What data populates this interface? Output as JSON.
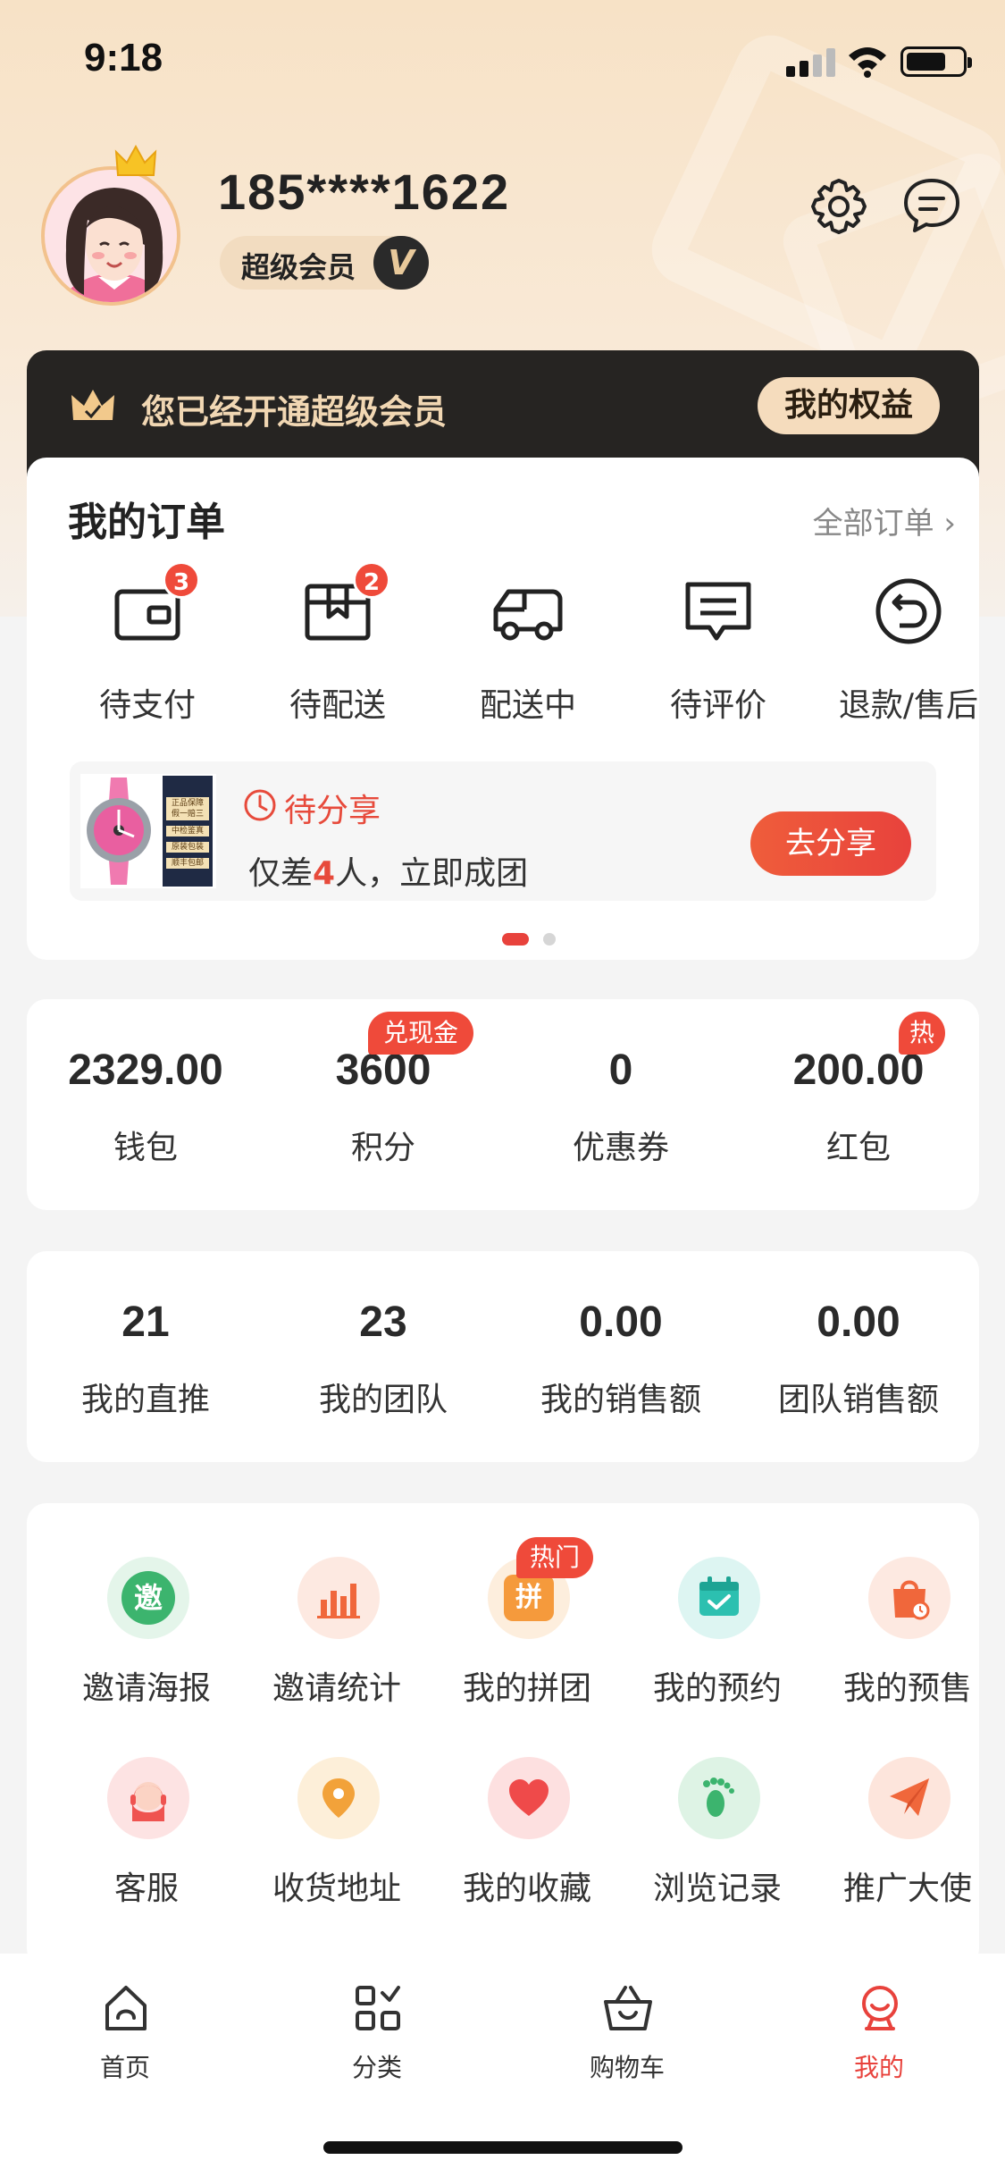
{
  "status_bar": {
    "time": "9:18",
    "battery_level": 0.7
  },
  "profile": {
    "phone": "185****1622",
    "member_label": "超级会员",
    "member_mark": "V"
  },
  "vip_banner": {
    "text": "您已经开通超级会员",
    "button": "我的权益"
  },
  "orders": {
    "title": "我的订单",
    "all_link": "全部订单",
    "items": [
      {
        "label": "待支付",
        "badge": "3",
        "icon": "wallet-icon"
      },
      {
        "label": "待配送",
        "badge": "2",
        "icon": "package-icon"
      },
      {
        "label": "配送中",
        "badge": "",
        "icon": "truck-icon"
      },
      {
        "label": "待评价",
        "badge": "",
        "icon": "comment-icon"
      },
      {
        "label": "退款/售后",
        "badge": "",
        "icon": "refund-icon"
      }
    ],
    "share": {
      "status": "待分享",
      "desc_prefix": "仅差",
      "desc_count": "4",
      "desc_suffix": "人，立即成团",
      "button": "去分享",
      "image_lines": [
        "正品保障",
        "假一赔三",
        "中检鉴真",
        "原装包装",
        "顺丰包邮"
      ]
    }
  },
  "assets": [
    {
      "value": "2329.00",
      "label": "钱包"
    },
    {
      "value": "3600",
      "label": "积分",
      "tag": "兑现金"
    },
    {
      "value": "0",
      "label": "优惠券"
    },
    {
      "value": "200.00",
      "label": "红包",
      "tag": "热"
    }
  ],
  "team": [
    {
      "value": "21",
      "label": "我的直推"
    },
    {
      "value": "23",
      "label": "我的团队"
    },
    {
      "value": "0.00",
      "label": "我的销售额"
    },
    {
      "value": "0.00",
      "label": "团队销售额"
    }
  ],
  "services": [
    {
      "label": "邀请海报",
      "icon": "invite-poster-icon",
      "glyph": "邀",
      "color": "#3cb46e"
    },
    {
      "label": "邀请统计",
      "icon": "bar-chart-icon",
      "color": "#f0673b"
    },
    {
      "label": "我的拼团",
      "icon": "group-buy-icon",
      "glyph": "拼",
      "color": "#f59a3c",
      "tag": "热门"
    },
    {
      "label": "我的预约",
      "icon": "calendar-check-icon",
      "color": "#2cc0b0"
    },
    {
      "label": "我的预售",
      "icon": "presale-bag-icon",
      "color": "#f0673b"
    },
    {
      "label": "客服",
      "icon": "customer-service-icon",
      "color": "#ef5350"
    },
    {
      "label": "收货地址",
      "icon": "location-pin-icon",
      "color": "#f2a23a"
    },
    {
      "label": "我的收藏",
      "icon": "heart-icon",
      "color": "#ef4a4a"
    },
    {
      "label": "浏览记录",
      "icon": "footprint-icon",
      "color": "#3cb46e"
    },
    {
      "label": "推广大使",
      "icon": "paper-plane-icon",
      "color": "#f0673b"
    }
  ],
  "tabbar": [
    {
      "label": "首页",
      "icon": "home-icon",
      "active": false
    },
    {
      "label": "分类",
      "icon": "category-icon",
      "active": false
    },
    {
      "label": "购物车",
      "icon": "basket-icon",
      "active": false
    },
    {
      "label": "我的",
      "icon": "profile-icon",
      "active": true
    }
  ],
  "colors": {
    "accent": "#e8423c",
    "gold": "#f1d7b3",
    "dark": "#262422"
  }
}
